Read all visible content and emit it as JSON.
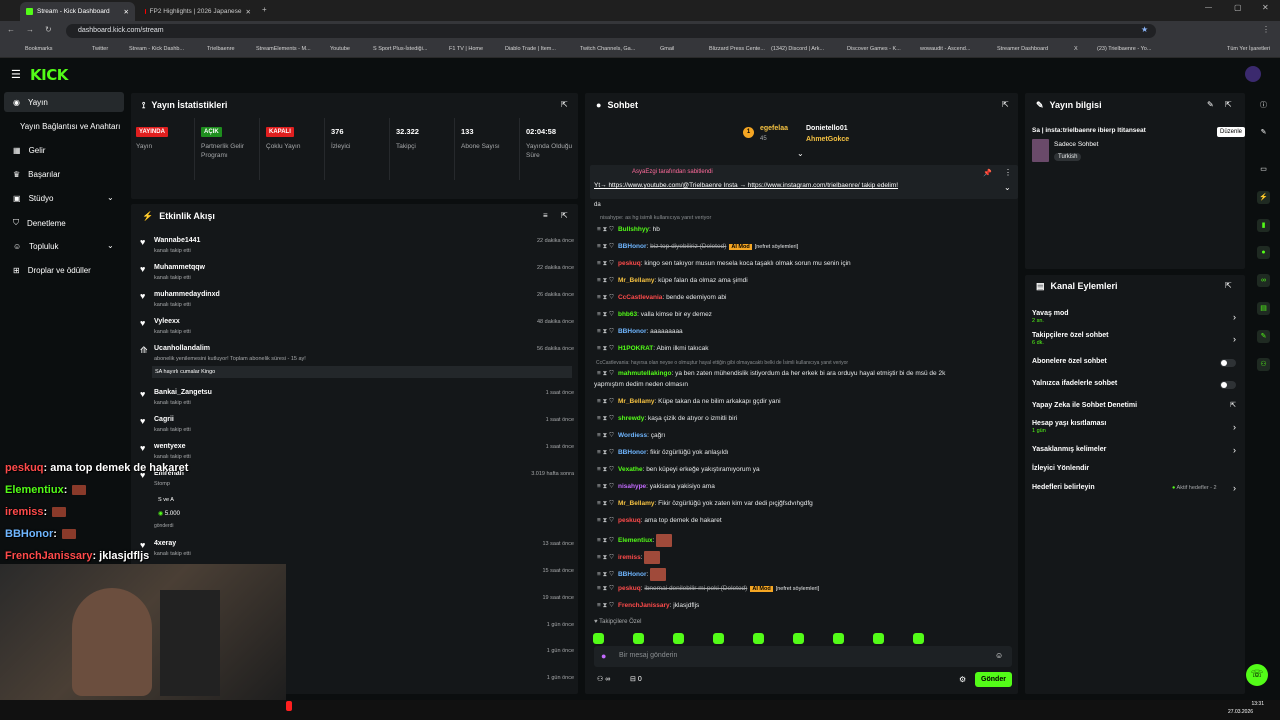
{
  "browser": {
    "tabs": [
      {
        "title": "Stream - Kick Dashboard"
      },
      {
        "title": "FP2 Highlights | 2026 Japanese"
      }
    ],
    "url": "dashboard.kick.com/stream",
    "bookmarks": [
      "Bookmarks",
      "Twitter",
      "Stream - Kick Dashb...",
      "Trielbaenre",
      "StreamElements - M...",
      "Youtube",
      "S Sport Plus-İstediği...",
      "F1 TV | Home",
      "Diablo Trade | Item...",
      "Twitch Channels, Ga...",
      "Gmail",
      "Blizzard Press Cente...",
      "(1342) Discord | Ark...",
      "Discover Games - K...",
      "wowaudit - Ascend...",
      "Streamer Dashboard",
      "X",
      "(23) Trielbaenre - Yo...",
      "Tüm Yer İşaretleri"
    ]
  },
  "sidebar": {
    "items": [
      {
        "label": "Yayın",
        "active": true
      },
      {
        "label": "Yayın Bağlantısı ve Anahtarı"
      },
      {
        "label": "Gelir"
      },
      {
        "label": "Başarılar"
      },
      {
        "label": "Stüdyo"
      },
      {
        "label": "Denetleme"
      },
      {
        "label": "Topluluk"
      },
      {
        "label": "Droplar ve ödüller"
      }
    ]
  },
  "stats": {
    "title": "Yayın İstatistikleri",
    "cells": [
      {
        "badge": "YAYINDA",
        "badge_color": "#e01f1f",
        "label": "Yayın"
      },
      {
        "badge": "AÇIK",
        "badge_color": "#1e8f1e",
        "label": "Partnerlik Gelir Programı"
      },
      {
        "badge": "KAPALI",
        "badge_color": "#e01f1f",
        "label": "Çoklu Yayın"
      },
      {
        "value": "376",
        "label": "İzleyici"
      },
      {
        "value": "32.322",
        "label": "Takipçi"
      },
      {
        "value": "133",
        "label": "Abone Sayısı"
      },
      {
        "value": "02:04:58",
        "label": "Yayında Olduğu Süre"
      }
    ]
  },
  "activity": {
    "title": "Etkinlik Akışı",
    "events": [
      {
        "name": "Wannabe1441",
        "sub": "kanalı takip etti",
        "time": "22 dakika önce"
      },
      {
        "name": "Muhammetqqw",
        "sub": "kanalı takip etti",
        "time": "22 dakika önce"
      },
      {
        "name": "muhammedaydinxd",
        "sub": "kanalı takip etti",
        "time": "26 dakika önce"
      },
      {
        "name": "Vyleexx",
        "sub": "kanalı takip etti",
        "time": "48 dakika önce"
      },
      {
        "name": "Ucanhollandalim",
        "sub": "abonelik yenilemesini kutluyor! Toplam abonelik süresi - 15 ay!",
        "time": "56 dakika önce",
        "note": "SA hayırlı cumalar Kingo"
      },
      {
        "name": "Bankai_Zangetsu",
        "sub": "kanalı takip etti",
        "time": "1 saat önce"
      },
      {
        "name": "Cagrii",
        "sub": "kanalı takip etti",
        "time": "1 saat önce"
      },
      {
        "name": "wentyexe",
        "sub": "kanalı takip etti",
        "time": "1 saat önce"
      },
      {
        "name": "Emrehan",
        "sub": "Stomp",
        "time": "3.019 hafta sonra",
        "extra": "S ve A",
        "amount": "5.000",
        "sent": "gönderdi"
      },
      {
        "name": "4xeray",
        "sub": "kanalı takip etti",
        "time": "13 saat önce"
      },
      {
        "name": "",
        "sub": "",
        "time": "15 saat önce"
      },
      {
        "name": "",
        "sub": "",
        "time": "19 saat önce"
      },
      {
        "name": "",
        "sub": "",
        "time": "1 gün önce"
      },
      {
        "name": "",
        "sub": "",
        "time": "1 gün önce"
      },
      {
        "name": "",
        "sub": "",
        "time": "1 gün önce"
      }
    ]
  },
  "chat": {
    "title": "Sohbet",
    "top_gifters": [
      {
        "rank": "1",
        "name": "egefelaa",
        "count": "45"
      },
      {
        "name": "Donietello01"
      },
      {
        "name": "AhmetGokce"
      }
    ],
    "pinned_by": "AsyaEzgi tarafından sabitlendi",
    "pinned_text": "Yt→ https://www.youtube.com/@Trielbaenre Insta → https://www.instagram.com/trielbaenre/ takip edelim!",
    "pinned_cont": "da",
    "reply1": "nisahype: as hg isimli kullanıcıya yanıt veriyor",
    "messages": [
      {
        "user": "Bullshhyy",
        "color": "#53fc18",
        "text": "hb"
      },
      {
        "user": "BBHonor",
        "color": "#6fb6ff",
        "text": "biz top diyebiliriz (Deleted)",
        "tag": "AI Mod",
        "tag2": "[nefret söylemleri]"
      },
      {
        "user": "peskuq",
        "color": "#ff4b4b",
        "text": "kingo sen takıyor musun mesela koca taşaklı olmak sorun mu senin için"
      },
      {
        "user": "Mr_Bellamy",
        "color": "#f5c242",
        "text": "küpe falan da olmaz ama şimdi"
      },
      {
        "user": "CcCastlevania",
        "color": "#ff4b4b",
        "text": "bende edemiyom abi"
      },
      {
        "user": "bhb63",
        "color": "#53fc18",
        "text": "valla kimse bir ey demez"
      },
      {
        "user": "BBHonor",
        "color": "#6fb6ff",
        "text": "aaaaaaaaa"
      },
      {
        "user": "H1POKRAT",
        "color": "#53fc18",
        "text": "Abim ilkmi takıcak"
      }
    ],
    "reply2": "CcCastlevania: hayırsa olan neyse o olmuştur hayal ettiğin gibi olmayacaktı belki de İsimli kullanıcıya yanıt veriyor",
    "messages2": [
      {
        "user": "mahmutellakingo",
        "color": "#53fc18",
        "text": "ya ben zaten mühendislik istiyordum da her erkek bi ara orduyu hayal etmiştir bi de msü de 2k"
      },
      {
        "user": "",
        "color": "#e7e9ea",
        "text": "yapmıştım dedim neden olmasın"
      },
      {
        "user": "Mr_Bellamy",
        "color": "#f5c242",
        "text": "Küpe takan da ne bilim arkakapı gçdir yani"
      },
      {
        "user": "shrewdy",
        "color": "#53fc18",
        "text": "kaşa çizik de atıyor o izmitli biri"
      },
      {
        "user": "Wordiess",
        "color": "#6fb6ff",
        "text": "çağrı"
      },
      {
        "user": "BBHonor",
        "color": "#6fb6ff",
        "text": "fikir özgürlüğü yok anlaşıldı"
      },
      {
        "user": "Vexathe",
        "color": "#53fc18",
        "text": "ben küpeyi erkeğe yakıştıramıyorum ya"
      },
      {
        "user": "nisahype",
        "color": "#c46bff",
        "text": "yakisana yakisiyo ama"
      },
      {
        "user": "Mr_Bellamy",
        "color": "#f5c242",
        "text": "Fikir özgürlüğü yok zaten kim var dedi pıçjğfsdvıhgdfg"
      },
      {
        "user": "peskuq",
        "color": "#ff4b4b",
        "text": "ama top demek de hakaret"
      },
      {
        "user": "Elementiux",
        "color": "#53fc18",
        "text": ""
      },
      {
        "user": "iremiss",
        "color": "#ff4b4b",
        "text": ""
      },
      {
        "user": "BBHonor",
        "color": "#6fb6ff",
        "text": ""
      },
      {
        "user": "peskuq",
        "color": "#ff4b4b",
        "text": "ibnemai denilebilir mi peki (Deleted)",
        "tag": "AI Mod",
        "tag2": "[nefret söylemleri]"
      },
      {
        "user": "FrenchJanissary",
        "color": "#ff4b4b",
        "text": "jklasjdfljs"
      }
    ],
    "follower_only": "Takipçilere Özel",
    "input_placeholder": "Bir mesaj gönderin",
    "points": "0",
    "send_label": "Gönder"
  },
  "stream_info": {
    "title": "Yayın bilgisi",
    "tooltip": "Düzenle",
    "stream_title": "Sa | insta:trielbaenre ibierp ltitanseat",
    "category": "Sadece Sohbet",
    "language": "Turkish"
  },
  "channel_actions": {
    "title": "Kanal Eylemleri",
    "items": [
      {
        "label": "Yavaş mod",
        "sub": "2 sn."
      },
      {
        "label": "Takipçilere özel sohbet",
        "sub": "6 dk."
      },
      {
        "label": "Abonelere özel sohbet"
      },
      {
        "label": "Yalnızca ifadelerle sohbet"
      },
      {
        "label": "Yapay Zeka ile Sohbet Denetimi"
      },
      {
        "label": "Hesap yaşı kısıtlaması",
        "sub": "1 gün"
      },
      {
        "label": "Yasaklanmış kelimeler"
      },
      {
        "label": "İzleyici Yönlendir"
      },
      {
        "label": "Hedefleri belirleyin",
        "right": "Aktif hedefler - 2"
      }
    ]
  },
  "overlay_chat": [
    {
      "user": "peskuq",
      "color": "#ff4b4b",
      "text": ": ama top demek de hakaret"
    },
    {
      "user": "Elementiux",
      "color": "#53fc18",
      "text": ":"
    },
    {
      "user": "iremiss",
      "color": "#ff4b4b",
      "text": ":"
    },
    {
      "user": "BBHonor",
      "color": "#6fb6ff",
      "text": ":"
    },
    {
      "user": "FrenchJanissary",
      "color": "#ff4b4b",
      "text": ": jklasjdfljs"
    }
  ],
  "taskbar": {
    "time": "13:31",
    "date": "27.03.2026"
  }
}
